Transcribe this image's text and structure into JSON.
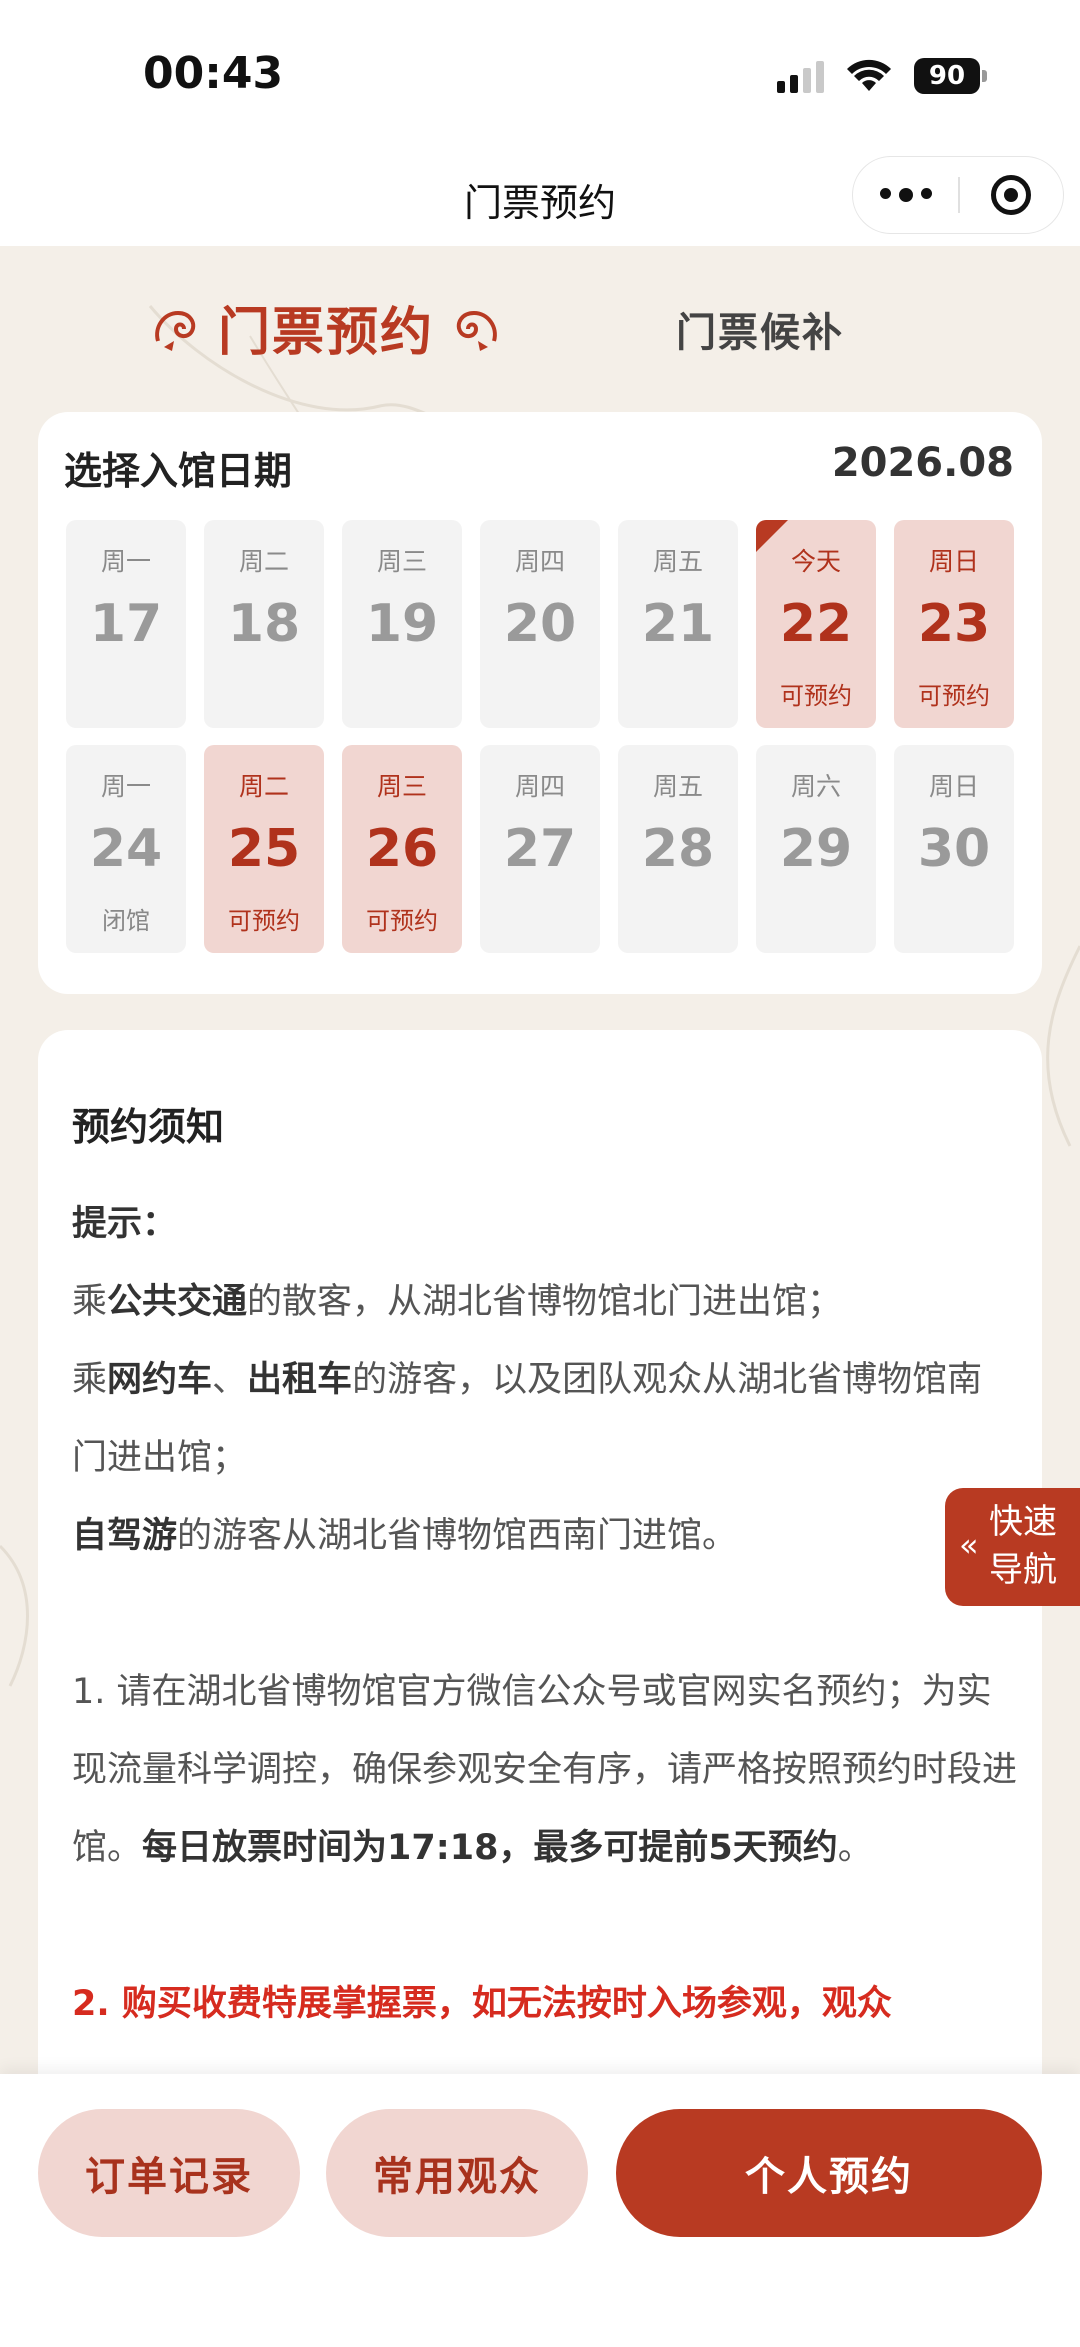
{
  "status_bar": {
    "time": "00:43",
    "battery": "90"
  },
  "nav": {
    "title": "门票预约"
  },
  "tabs": {
    "active": "门票预约",
    "other": "门票候补"
  },
  "calendar": {
    "title": "选择入馆日期",
    "month": "2026.08",
    "days": [
      {
        "weekday": "周一",
        "num": "17",
        "status": "",
        "available": false
      },
      {
        "weekday": "周二",
        "num": "18",
        "status": "",
        "available": false
      },
      {
        "weekday": "周三",
        "num": "19",
        "status": "",
        "available": false
      },
      {
        "weekday": "周四",
        "num": "20",
        "status": "",
        "available": false
      },
      {
        "weekday": "周五",
        "num": "21",
        "status": "",
        "available": false
      },
      {
        "weekday": "今天",
        "num": "22",
        "status": "可预约",
        "available": true
      },
      {
        "weekday": "周日",
        "num": "23",
        "status": "可预约",
        "available": true
      },
      {
        "weekday": "周一",
        "num": "24",
        "status": "闭馆",
        "available": false
      },
      {
        "weekday": "周二",
        "num": "25",
        "status": "可预约",
        "available": true
      },
      {
        "weekday": "周三",
        "num": "26",
        "status": "可预约",
        "available": true
      },
      {
        "weekday": "周四",
        "num": "27",
        "status": "",
        "available": false
      },
      {
        "weekday": "周五",
        "num": "28",
        "status": "",
        "available": false
      },
      {
        "weekday": "周六",
        "num": "29",
        "status": "",
        "available": false
      },
      {
        "weekday": "周日",
        "num": "30",
        "status": "",
        "available": false
      }
    ]
  },
  "notice": {
    "title": "预约须知",
    "tip_label": "提示：",
    "line1_a": "乘",
    "line1_b": "公共交通",
    "line1_c": "的散客，从湖北省博物馆北门进出馆；",
    "line2_a": "乘",
    "line2_b": "网约车",
    "line2_c": "、",
    "line2_d": "出租车",
    "line2_e": "的游客，以及团队观众从湖北省博物馆南门进出馆；",
    "line3_a": "自驾游",
    "line3_b": "的游客从湖北省博物馆西南门进馆。",
    "item1_a": "1. 请在湖北省博物馆官方微信公众号或官网实名预约；为实现流量科学调控，确保参观安全有序，请严格按照预约时段进馆。",
    "item1_b": "每日放票时间为17:18，最多可提前5天预约",
    "item1_c": "。",
    "item2": "2. 购买收费特展掌握票，如无法按时入场参观，观众"
  },
  "quick_nav": {
    "label": "快速导航"
  },
  "bottom": {
    "orders": "订单记录",
    "visitors": "常用观众",
    "reserve": "个人预约"
  },
  "colors": {
    "accent": "#b83a22",
    "accent_light": "#f1d6d1",
    "bg": "#f4efe8"
  }
}
